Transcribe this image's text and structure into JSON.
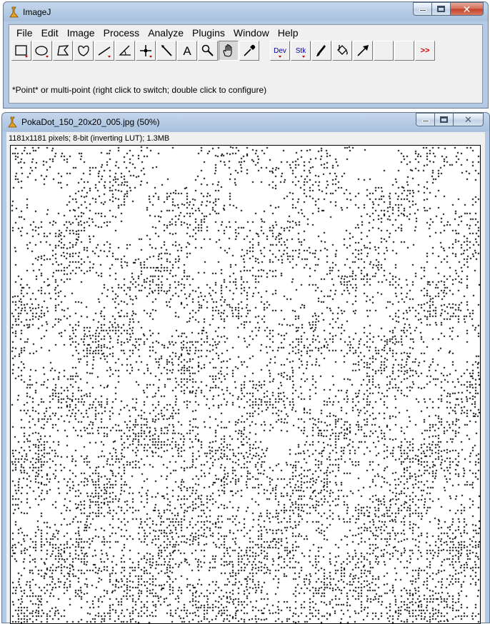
{
  "main_window": {
    "title": "ImageJ",
    "menu": [
      "File",
      "Edit",
      "Image",
      "Process",
      "Analyze",
      "Plugins",
      "Window",
      "Help"
    ],
    "tools": [
      {
        "name": "rectangle-tool",
        "icon": "rectangle-icon"
      },
      {
        "name": "oval-tool",
        "icon": "oval-icon"
      },
      {
        "name": "polygon-tool",
        "icon": "polygon-icon"
      },
      {
        "name": "freehand-tool",
        "icon": "freehand-icon"
      },
      {
        "name": "line-tool",
        "icon": "line-icon"
      },
      {
        "name": "angle-tool",
        "icon": "angle-icon"
      },
      {
        "name": "point-tool",
        "icon": "point-icon"
      },
      {
        "name": "wand-tool",
        "icon": "wand-icon"
      },
      {
        "name": "text-tool",
        "icon": "text-icon"
      },
      {
        "name": "magnifier-tool",
        "icon": "magnifier-icon"
      },
      {
        "name": "hand-tool",
        "icon": "hand-icon"
      },
      {
        "name": "color-picker-tool",
        "icon": "dropper-icon"
      },
      {
        "name": "dev-menu",
        "label": "Dev"
      },
      {
        "name": "stk-menu",
        "label": "Stk"
      },
      {
        "name": "brush-tool",
        "icon": "brush-icon"
      },
      {
        "name": "flood-fill-tool",
        "icon": "bucket-icon"
      },
      {
        "name": "arrow-tool",
        "icon": "arrow-icon"
      }
    ],
    "more_label": ">>",
    "status_text": "*Point* or multi-point (right click to switch; double click to configure)"
  },
  "image_window": {
    "title": "PokaDot_150_20x20_005.jpg (50%)",
    "info": "1181x1181 pixels; 8-bit (inverting LUT); 1.3MB"
  },
  "colors": {
    "title_bar": "#b4c9e3",
    "close_button": "#c2412a",
    "panel": "#f0f0f0",
    "dot": "#000000",
    "dev_text": "#0000a8",
    "more_text": "#d00000"
  }
}
